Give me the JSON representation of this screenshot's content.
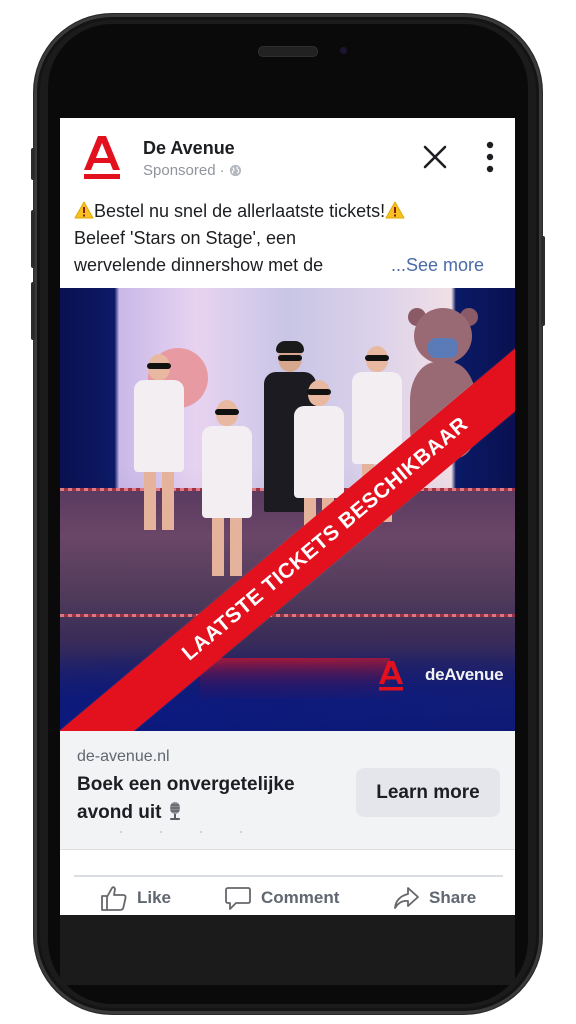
{
  "post": {
    "page_name": "De Avenue",
    "sponsored_label": "Sponsored",
    "separator": "·",
    "audience_icon": "globe-icon",
    "text_lines": [
      "Bestel nu snel de allerlaatste tickets!",
      "Beleef 'Stars on Stage', een",
      "wervelende dinnershow met de"
    ],
    "see_more_label": "...See more",
    "emoji_line1": "warning-emoji"
  },
  "image": {
    "banner_text": "LAATSTE TICKETS BESCHIKBAAR",
    "watermark_text": "deAvenue",
    "brand_color": "#e3101d"
  },
  "link": {
    "domain": "de-avenue.nl",
    "headline_line1": "Boek een onvergetelijke",
    "headline_line2": "avond uit",
    "headline_emoji": "microphone-emoji",
    "cta_label": "Learn more"
  },
  "actions": [
    {
      "label": "Like",
      "icon": "thumbs-up-icon"
    },
    {
      "label": "Comment",
      "icon": "comment-icon"
    },
    {
      "label": "Share",
      "icon": "share-icon"
    }
  ],
  "colors": {
    "link_blue": "#4b6aa8",
    "text_primary": "#1c1e21",
    "text_secondary": "#606770",
    "cta_bg": "#e4e6eb"
  }
}
